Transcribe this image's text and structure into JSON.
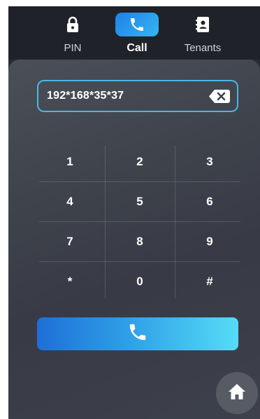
{
  "tabs": [
    {
      "label": "PIN",
      "icon": "lock-icon",
      "active": false
    },
    {
      "label": "Call",
      "icon": "phone-icon",
      "active": true
    },
    {
      "label": "Tenants",
      "icon": "contact-book-icon",
      "active": false
    }
  ],
  "dial": {
    "value": "192*168*35*37",
    "backspace_icon": "backspace-icon"
  },
  "keypad": {
    "keys": [
      "1",
      "2",
      "3",
      "4",
      "5",
      "6",
      "7",
      "8",
      "9",
      "*",
      "0",
      "#"
    ]
  },
  "call_button": {
    "icon": "phone-icon"
  },
  "home_button": {
    "icon": "home-icon"
  },
  "colors": {
    "accent": "#2f9fe6",
    "accent_light": "#55dcf7",
    "input_border": "#49b6e8",
    "tabbar_bg": "#1f2228"
  }
}
